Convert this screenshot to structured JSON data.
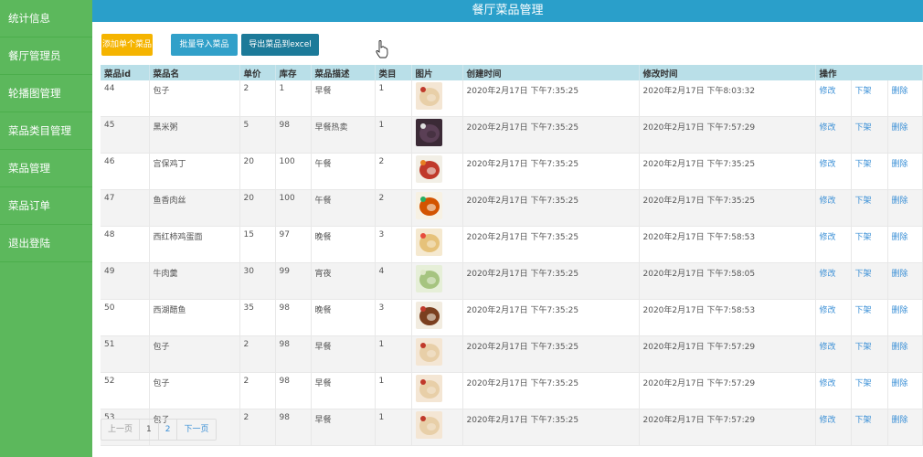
{
  "sidebar": {
    "items": [
      {
        "label": "统计信息"
      },
      {
        "label": "餐厅管理员"
      },
      {
        "label": "轮播图管理"
      },
      {
        "label": "菜品类目管理"
      },
      {
        "label": "菜品管理"
      },
      {
        "label": "菜品订单"
      },
      {
        "label": "退出登陆"
      }
    ]
  },
  "header": {
    "title": "餐厅菜品管理"
  },
  "toolbar": {
    "add_label": "添加单个菜品",
    "import_label": "批量导入菜品",
    "export_label": "导出菜品到excel"
  },
  "table": {
    "headers": [
      "菜品id",
      "菜品名",
      "单价",
      "库存",
      "菜品描述",
      "类目",
      "图片",
      "创建时间",
      "修改时间",
      "操作"
    ],
    "rows": [
      {
        "id": "44",
        "name": "包子",
        "price": "2",
        "stock": "1",
        "desc": "早餐",
        "category": "1",
        "image": "baozi-icon",
        "created": "2020年2月17日 下午7:35:25",
        "modified": "2020年2月17日 下午8:03:32"
      },
      {
        "id": "45",
        "name": "黑米粥",
        "price": "5",
        "stock": "98",
        "desc": "早餐热卖",
        "category": "1",
        "image": "congee-icon",
        "created": "2020年2月17日 下午7:35:25",
        "modified": "2020年2月17日 下午7:57:29"
      },
      {
        "id": "46",
        "name": "宫保鸡丁",
        "price": "20",
        "stock": "100",
        "desc": "午餐",
        "category": "2",
        "image": "chicken-dish-icon",
        "created": "2020年2月17日 下午7:35:25",
        "modified": "2020年2月17日 下午7:35:25"
      },
      {
        "id": "47",
        "name": "鱼香肉丝",
        "price": "20",
        "stock": "100",
        "desc": "午餐",
        "category": "2",
        "image": "pork-dish-icon",
        "created": "2020年2月17日 下午7:35:25",
        "modified": "2020年2月17日 下午7:35:25"
      },
      {
        "id": "48",
        "name": "西红柿鸡蛋面",
        "price": "15",
        "stock": "97",
        "desc": "晚餐",
        "category": "3",
        "image": "noodle-icon",
        "created": "2020年2月17日 下午7:35:25",
        "modified": "2020年2月17日 下午7:58:53"
      },
      {
        "id": "49",
        "name": "牛肉羹",
        "price": "30",
        "stock": "99",
        "desc": "宵夜",
        "category": "4",
        "image": "soup-icon",
        "created": "2020年2月17日 下午7:35:25",
        "modified": "2020年2月17日 下午7:58:05"
      },
      {
        "id": "50",
        "name": "西湖醋鱼",
        "price": "35",
        "stock": "98",
        "desc": "晚餐",
        "category": "3",
        "image": "fish-dish-icon",
        "created": "2020年2月17日 下午7:35:25",
        "modified": "2020年2月17日 下午7:58:53"
      },
      {
        "id": "51",
        "name": "包子",
        "price": "2",
        "stock": "98",
        "desc": "早餐",
        "category": "1",
        "image": "baozi-icon",
        "created": "2020年2月17日 下午7:35:25",
        "modified": "2020年2月17日 下午7:57:29"
      },
      {
        "id": "52",
        "name": "包子",
        "price": "2",
        "stock": "98",
        "desc": "早餐",
        "category": "1",
        "image": "baozi-icon",
        "created": "2020年2月17日 下午7:35:25",
        "modified": "2020年2月17日 下午7:57:29"
      },
      {
        "id": "53",
        "name": "包子",
        "price": "2",
        "stock": "98",
        "desc": "早餐",
        "category": "1",
        "image": "baozi-icon",
        "created": "2020年2月17日 下午7:35:25",
        "modified": "2020年2月17日 下午7:57:29"
      }
    ],
    "actions": {
      "edit": "修改",
      "unlist": "下架",
      "delete": "删除"
    }
  },
  "pagination": {
    "prev": "上一页",
    "pages": [
      "1",
      "2"
    ],
    "next": "下一页"
  },
  "colors": {
    "sidebar": "#5cb85c",
    "header": "#2a9fca",
    "table_header": "#b9dfe8",
    "link": "#3a8fd6"
  }
}
